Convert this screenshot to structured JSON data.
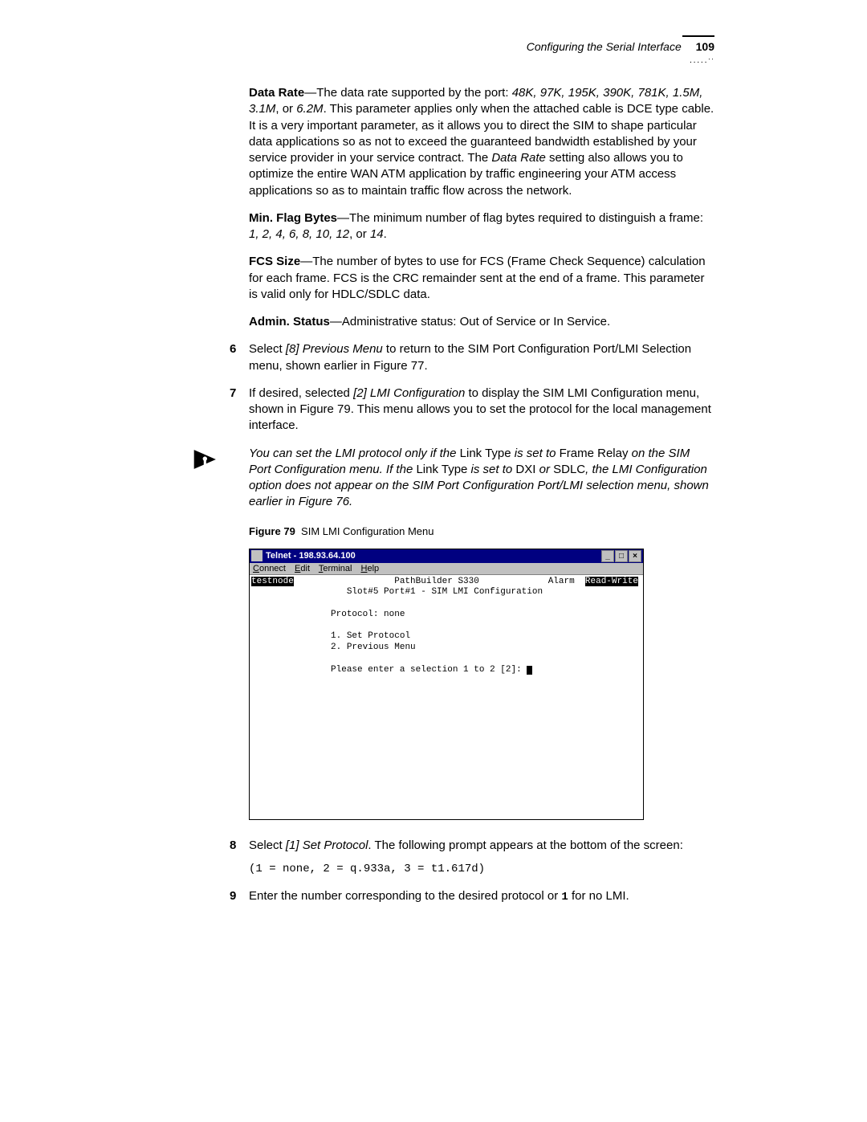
{
  "header": {
    "section": "Configuring the Serial Interface",
    "page": "109"
  },
  "paras": {
    "datarate_lead": "Data Rate",
    "datarate_body1": "—The data rate supported by the port: ",
    "datarate_vals": "48K, 97K, 195K, 390K, 781K, 1.5M, 3.1M",
    "datarate_or": ", or ",
    "datarate_last": "6.2M",
    "datarate_body2": ". This parameter applies only when the attached cable is DCE type cable. It is a very important parameter, as it allows you to direct the SIM to shape particular data applications so as not to exceed the guaranteed bandwidth established by your service provider in your service contract. The ",
    "datarate_term": "Data Rate",
    "datarate_body3": " setting also allows you to optimize the entire WAN ATM application by traffic engineering your ATM access applications so as to maintain traffic flow across the network.",
    "minflag_lead": "Min. Flag Bytes",
    "minflag_body1": "—The minimum number of flag bytes required to distinguish a frame: ",
    "minflag_vals": "1, 2, 4, 6, 8, 10, 12",
    "minflag_or": ", or ",
    "minflag_last": "14",
    "minflag_end": ".",
    "fcs_lead": "FCS Size",
    "fcs_body": "—The number of bytes to use for FCS (Frame Check Sequence) calculation for each frame. FCS is the CRC remainder sent at the end of a frame. This parameter is valid only for HDLC/SDLC data.",
    "admin_lead": "Admin. Status",
    "admin_body": "—Administrative status: Out of Service or In Service."
  },
  "steps": {
    "s6_num": "6",
    "s6_a": "Select ",
    "s6_b": "[8] Previous Menu",
    "s6_c": " to return to the SIM Port Configuration Port/LMI Selection menu, shown earlier in Figure 77.",
    "s7_num": "7",
    "s7_a": "If desired, selected ",
    "s7_b": "[2] LMI Configuration",
    "s7_c": " to display the SIM LMI Configuration menu, shown in Figure 79. This menu allows you to set the protocol for the local management interface.",
    "s8_num": "8",
    "s8_a": "Select ",
    "s8_b": "[1] Set Protocol",
    "s8_c": ". The following prompt appears at the bottom of the screen:",
    "s8_code": "(1 = none, 2 = q.933a, 3 = t1.617d)",
    "s9_num": "9",
    "s9_a": "Enter the number corresponding to the desired protocol or ",
    "s9_b": "1",
    "s9_c": " for no LMI."
  },
  "note": {
    "a": "You can set the LMI protocol only if the ",
    "b": "Link Type",
    "c": " is set to ",
    "d": "Frame Relay",
    "e": " on the SIM Port Configuration menu. If the ",
    "f": "Link Type",
    "g": " is set to ",
    "h": "DXI",
    "i": " or ",
    "j": "SDLC",
    "k": ", the LMI Configuration option does not appear on the SIM Port Configuration Port/LMI selection menu, shown earlier in Figure 76."
  },
  "figure": {
    "label": "Figure 79",
    "caption": "SIM LMI Configuration Menu"
  },
  "telnet": {
    "title": "Telnet - 198.93.64.100",
    "menu": {
      "connect": "Connect",
      "edit": "Edit",
      "terminal": "Terminal",
      "help": "Help"
    },
    "btn_min": "_",
    "btn_max": "□",
    "btn_close": "×",
    "node": "testnode",
    "product": "PathBuilder S330",
    "alarm": "Alarm",
    "rw": "Read-Write",
    "subtitle": "Slot#5 Port#1 - SIM LMI Configuration",
    "protocol": "Protocol: none",
    "opt1": "1. Set Protocol",
    "opt2": "2. Previous Menu",
    "prompt": "Please enter a selection 1 to 2 [2]: "
  }
}
